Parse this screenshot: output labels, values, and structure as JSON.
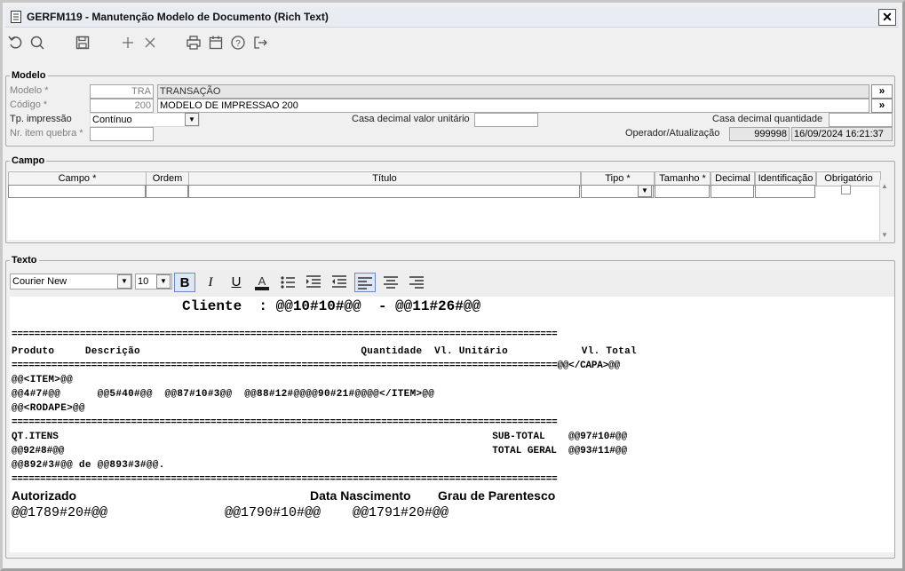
{
  "window": {
    "title": "GERFM119 - Manutenção Modelo de Documento (Rich Text)",
    "close": "✕"
  },
  "toolbar": [
    "undo-icon",
    "search-icon",
    "save-icon",
    "add-icon",
    "delete-icon",
    "print-icon",
    "calendar-icon",
    "help-icon",
    "exit-icon"
  ],
  "modelo": {
    "legend": "Modelo",
    "modelo_label": "Modelo *",
    "modelo_code": "TRA",
    "modelo_desc": "TRANSAÇÃO",
    "codigo_label": "Código *",
    "codigo_code": "200",
    "codigo_desc": "MODELO DE IMPRESSAO 200",
    "tp_label": "Tp. impressão",
    "tp_value": "Contínuo",
    "nr_label": "Nr. item quebra *",
    "casa_unit_label": "Casa decimal valor unitário",
    "casa_qtd_label": "Casa decimal quantidade",
    "operador_label": "Operador/Atualização",
    "operador_value": "999998",
    "atualizacao_value": "16/09/2024 16:21:37",
    "lookup": "»"
  },
  "campo": {
    "legend": "Campo",
    "headers": [
      "Campo *",
      "Ordem",
      "Título",
      "Tipo *",
      "Tamanho *",
      "Decimal",
      "Identificação",
      "Obrigatório"
    ]
  },
  "texto": {
    "legend": "Texto",
    "font": "Courier New",
    "size": "10",
    "lines": {
      "l1": "Cliente  : @@10#10#@@  - @@11#26#@@",
      "sep": "================================================================================================",
      "hdr": "Produto     Descrição                                    Quantidade  Vl. Unitário            Vl. Total",
      "sep2": "================================================================================================@@</CAPA>@@",
      "item": "@@<ITEM>@@",
      "itemline": "@@4#7#@@      @@5#40#@@  @@87#10#3@@  @@88#12#@@@@90#21#@@@@</ITEM>@@",
      "rodape": "@@<RODAPE>@@",
      "sep3": "================================================================================================",
      "qt": "QT.ITENS                                                                          SUB-TOTAL    @@97#10#@@",
      "qt2": "@@92#8#@@                                                                         TOTAL GERAL  @@93#11#@@",
      "qt3": "@@892#3#@@ de @@893#3#@@.",
      "sep4": "================================================================================================",
      "aut": "Autorizado",
      "datan": "Data Nascimento",
      "grau": "Grau de Parentesco",
      "var1": "@@1789#20#@@",
      "var2": "@@1790#10#@@",
      "var3": "@@1791#20#@@"
    }
  }
}
